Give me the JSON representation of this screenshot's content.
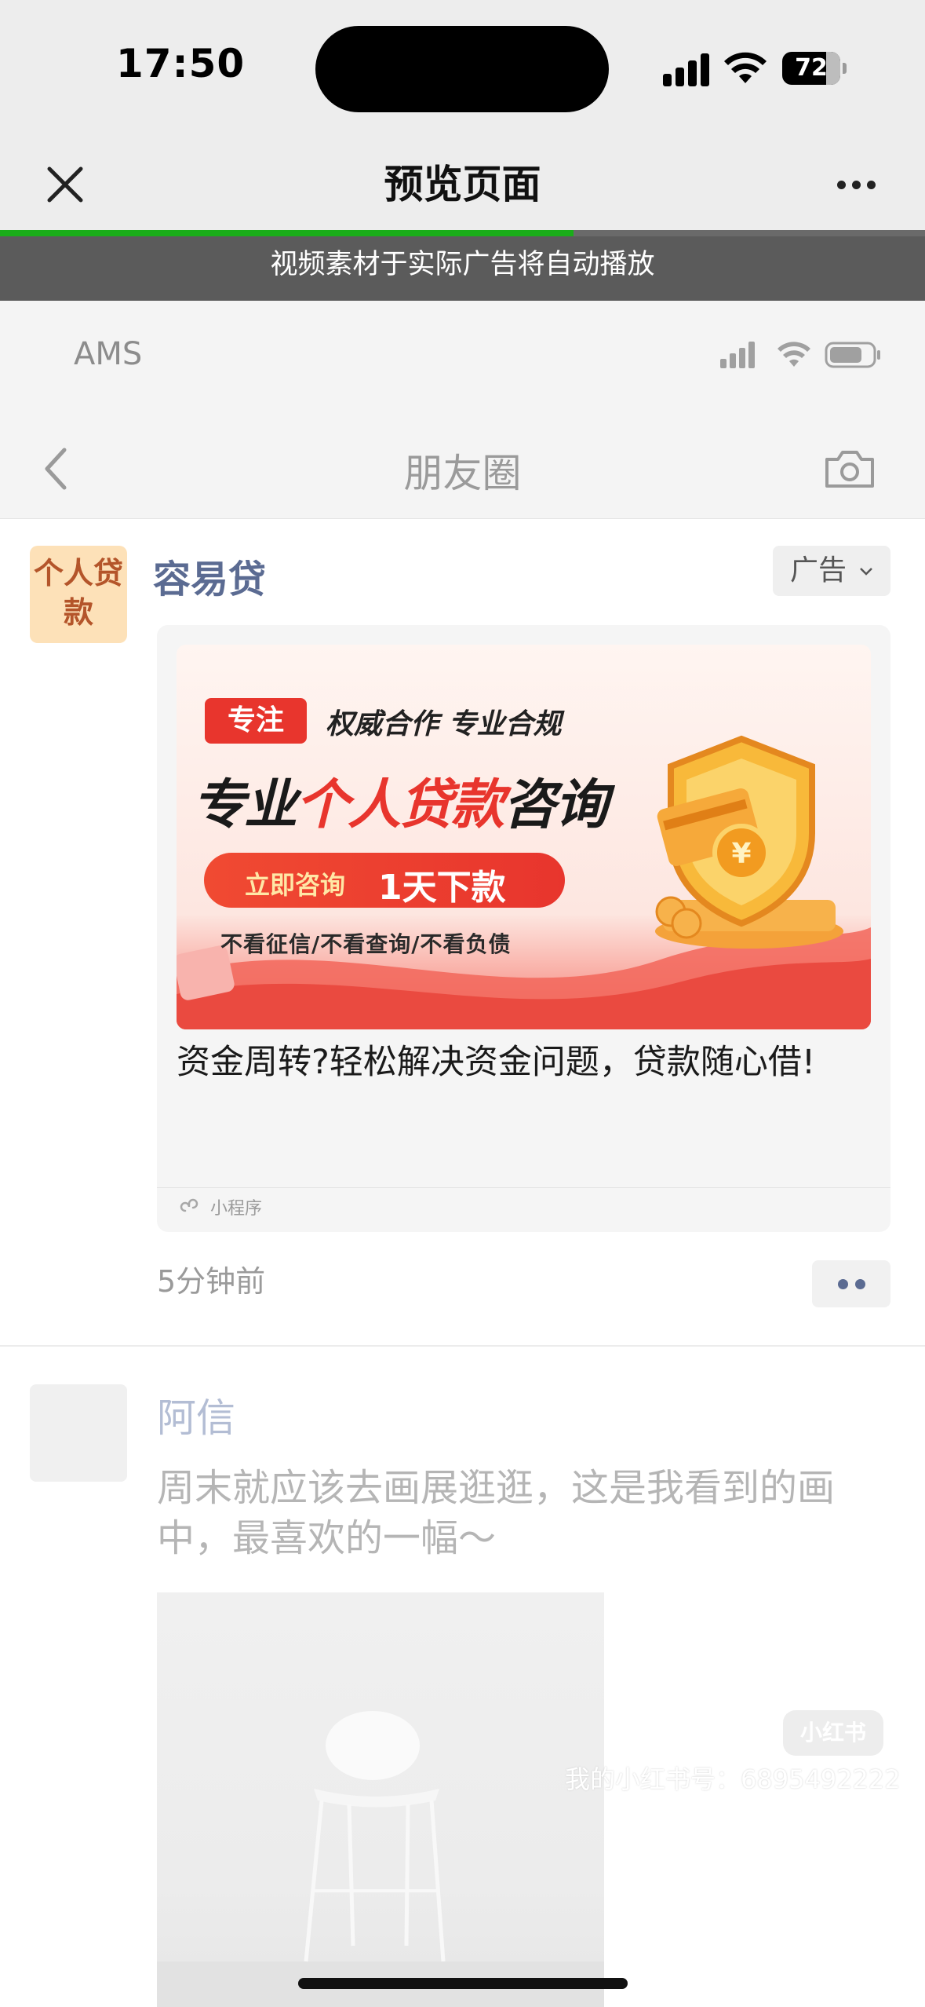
{
  "status_bar": {
    "time": "17:50",
    "battery": "72"
  },
  "nav": {
    "title": "预览页面"
  },
  "progress": {
    "fraction": 0.62,
    "color": "#1aad19"
  },
  "notice": "视频素材于实际广告将自动播放",
  "inner_status": {
    "carrier": "AMS"
  },
  "inner_nav": {
    "title": "朋友圈"
  },
  "ad_post": {
    "avatar_text": "个人贷款",
    "name": "容易贷",
    "tag": "广告",
    "banner": {
      "focus": "专注",
      "authority": "权威合作 专业合规",
      "headline_pre": "专业",
      "headline_red": "个人贷款",
      "headline_post": "咨询",
      "cta_left": "立即咨询",
      "cta_right": "1天下款",
      "sub": "不看征信/不看查询/不看负债"
    },
    "description": "资金周转?轻松解决资金问题，贷款随心借!",
    "mini_program": "小程序",
    "time": "5分钟前"
  },
  "second_post": {
    "name": "阿信",
    "text": "周末就应该去画展逛逛，这是我看到的画中，最喜欢的一幅～"
  },
  "watermark": {
    "badge": "小红书",
    "text": "我的小红书号：6895492222"
  }
}
